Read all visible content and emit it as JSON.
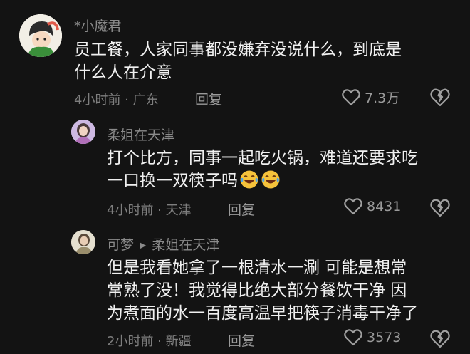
{
  "comments": [
    {
      "username": "*小魔君",
      "lines": [
        "员工餐，人家同事都没嫌弃没说什么，到底是",
        "什么人在介意"
      ],
      "time": "4小时前",
      "location": "广东",
      "reply_label": "回复",
      "likes": "7.3万"
    },
    {
      "username": "柔姐在天津",
      "lines": [
        "打个比方，同事一起吃火锅，难道还要求吃",
        "一口换一双筷子吗"
      ],
      "emojis": [
        "laugh-cry-emoji",
        "laugh-cry-emoji"
      ],
      "time": "4小时前",
      "location": "天津",
      "reply_label": "回复",
      "likes": "8431"
    },
    {
      "username": "可梦",
      "reply_to": "柔姐在天津",
      "lines": [
        "但是我看她拿了一根清水一涮 可能是想常",
        "常熟了没！我觉得比绝大部分餐饮干净 因",
        "为煮面的水一百度高温早把筷子消毒干净了"
      ],
      "time": "2小时前",
      "location": "新疆",
      "reply_label": "回复",
      "likes": "3573"
    }
  ],
  "separator": " · ",
  "colors": {
    "background": "#131313",
    "text": "#f0f0f0",
    "muted": "#8a8a8a"
  }
}
